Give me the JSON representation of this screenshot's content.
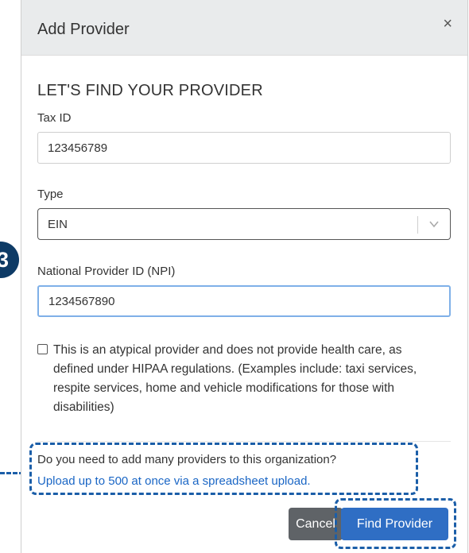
{
  "modal": {
    "title": "Add Provider",
    "close_label": "×"
  },
  "form": {
    "heading": "LET'S FIND YOUR PROVIDER",
    "tax_id": {
      "label": "Tax ID",
      "value": "123456789"
    },
    "type": {
      "label": "Type",
      "selected": "EIN"
    },
    "npi": {
      "label": "National Provider ID (NPI)",
      "value": "1234567890"
    },
    "atypical": {
      "checked": false,
      "label": "This is an atypical provider and does not provide health care, as defined under HIPAA regulations. (Examples include: taxi services, respite services, home and vehicle modifications for those with disabilities)"
    }
  },
  "bulk": {
    "question": "Do you need to add many providers to this organization?",
    "link": "Upload up to 500 at once via a spreadsheet upload."
  },
  "footer": {
    "cancel_label": "Cancel",
    "find_label": "Find Provider"
  },
  "annotation": {
    "step_number": "3",
    "accent_color": "#1b5ea8"
  }
}
